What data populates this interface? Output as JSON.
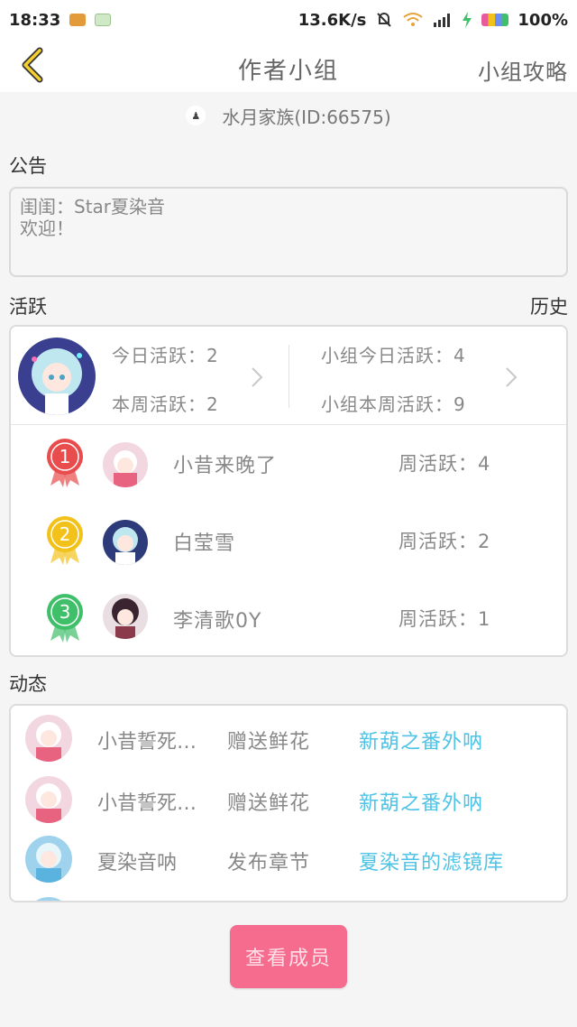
{
  "status_bar": {
    "time": "18:33",
    "speed": "13.6K/s",
    "battery": "100%",
    "icons": [
      "notification-app-icon",
      "android-icon",
      "mute-icon",
      "wifi-icon",
      "signal-icon",
      "charging-icon",
      "battery-icon"
    ]
  },
  "header": {
    "title": "作者小组",
    "guide_link": "小组攻略",
    "back_icon": "chevron-left-icon",
    "accent": "#f5cf2b"
  },
  "family": {
    "label": "水月家族(ID:66575)",
    "icon": "group-icon"
  },
  "notice": {
    "label": "公告",
    "lines": [
      "闺闺：Star夏染音",
      "欢迎！"
    ]
  },
  "activity": {
    "label": "活跃",
    "history": "历史",
    "today": "今日活跃：2",
    "week": "本周活跃：2",
    "group_today": "小组今日活跃：4",
    "group_week": "小组本周活跃：9"
  },
  "ranking": [
    {
      "rank": "1",
      "name": "小昔来晚了",
      "weekly": "周活跃：4",
      "medal_color": "#e84c4c"
    },
    {
      "rank": "2",
      "name": "白莹雪",
      "weekly": "周活跃：2",
      "medal_color": "#f2c21b"
    },
    {
      "rank": "3",
      "name": "李清歌0Y",
      "weekly": "周活跃：1",
      "medal_color": "#3fbf6a"
    }
  ],
  "dynamics": {
    "label": "动态",
    "items": [
      {
        "name": "小昔誓死…",
        "action": "赠送鲜花",
        "object": "新葫之番外呐"
      },
      {
        "name": "小昔誓死…",
        "action": "赠送鲜花",
        "object": "新葫之番外呐"
      },
      {
        "name": "夏染音呐",
        "action": "发布章节",
        "object": "夏染音的滤镜库"
      }
    ]
  },
  "members_button": "查看成员",
  "colors": {
    "link": "#4ec3e6",
    "button": "#f66c8f",
    "border": "#dcdcdc"
  }
}
